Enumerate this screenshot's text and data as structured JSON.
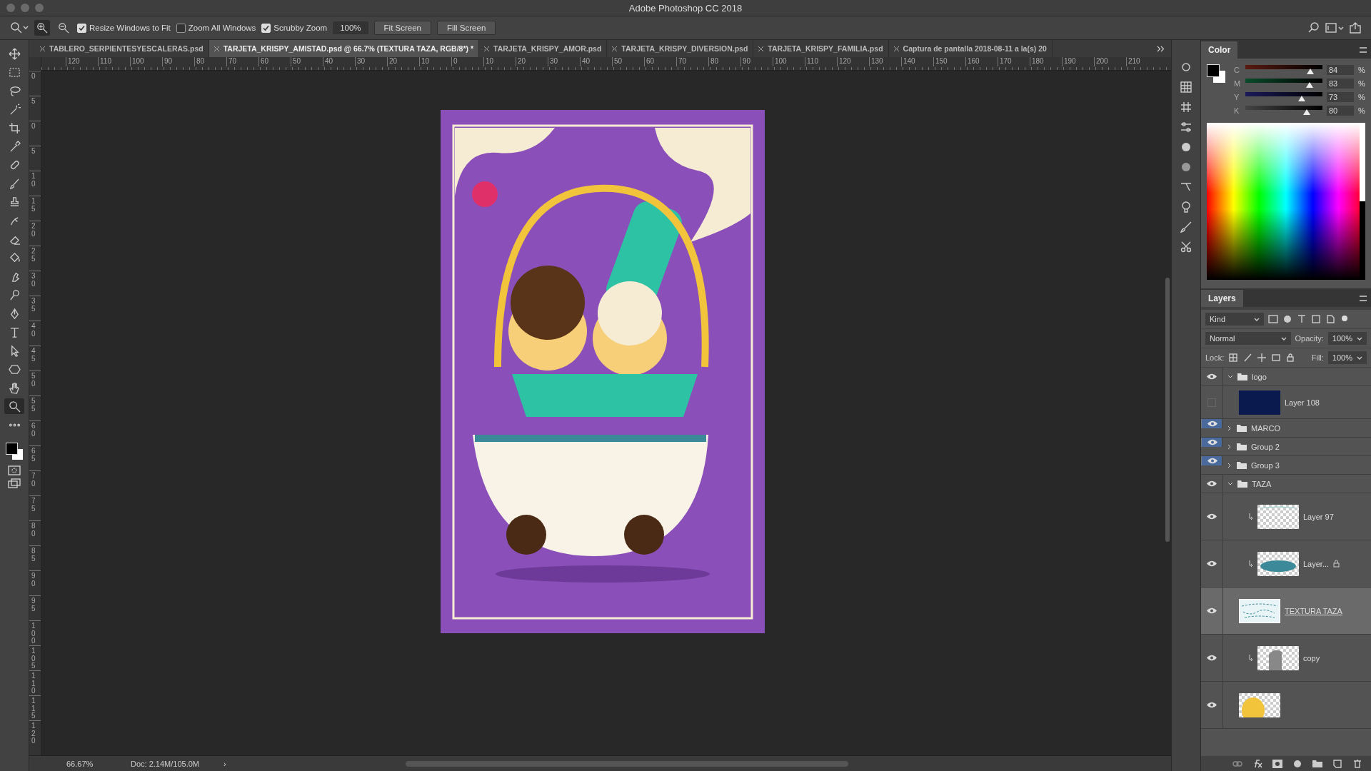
{
  "window": {
    "title": "Adobe Photoshop CC 2018"
  },
  "options_bar": {
    "options": [
      {
        "label": "Resize Windows to Fit",
        "checked": true
      },
      {
        "label": "Zoom All Windows",
        "checked": false
      },
      {
        "label": "Scrubby Zoom",
        "checked": true
      }
    ],
    "zoom_value": "100%",
    "buttons": [
      "Fit Screen",
      "Fill Screen"
    ]
  },
  "tools": [
    {
      "kind": "move",
      "selected": false
    },
    {
      "kind": "marquee",
      "selected": false
    },
    {
      "kind": "lasso",
      "selected": false
    },
    {
      "kind": "wand",
      "selected": false
    },
    {
      "kind": "crop",
      "selected": false
    },
    {
      "kind": "eyedropper",
      "selected": false
    },
    {
      "kind": "healing",
      "selected": false
    },
    {
      "kind": "brush",
      "selected": false
    },
    {
      "kind": "stamp",
      "selected": false
    },
    {
      "kind": "history",
      "selected": false
    },
    {
      "kind": "eraser",
      "selected": false
    },
    {
      "kind": "bucket",
      "selected": false
    },
    {
      "kind": "smudge",
      "selected": false
    },
    {
      "kind": "dodge",
      "selected": false
    },
    {
      "kind": "pen",
      "selected": false
    },
    {
      "kind": "type",
      "selected": false
    },
    {
      "kind": "select",
      "selected": false
    },
    {
      "kind": "shape",
      "selected": false
    },
    {
      "kind": "hand",
      "selected": false
    },
    {
      "kind": "zoom",
      "selected": true
    },
    {
      "kind": "more",
      "selected": false
    }
  ],
  "tabs": [
    {
      "label": "TABLERO_SERPIENTESYESCALERAS.psd",
      "selected": false
    },
    {
      "label": "TARJETA_KRISPY_AMISTAD.psd @ 66.7% (TEXTURA TAZA, RGB/8*) *",
      "selected": true
    },
    {
      "label": "TARJETA_KRISPY_AMOR.psd",
      "selected": false
    },
    {
      "label": "TARJETA_KRISPY_DIVERSION.psd",
      "selected": false
    },
    {
      "label": "TARJETA_KRISPY_FAMILIA.psd",
      "selected": false
    },
    {
      "label": "Captura de pantalla 2018-08-11 a la(s) 20",
      "selected": false
    }
  ],
  "rulers": {
    "horizontal": [
      "120",
      "110",
      "100",
      "90",
      "80",
      "70",
      "60",
      "50",
      "40",
      "30",
      "20",
      "10",
      "0",
      "10",
      "20",
      "30",
      "40",
      "50",
      "60",
      "70",
      "80",
      "90",
      "100",
      "110",
      "120",
      "130",
      "140",
      "150",
      "160",
      "170",
      "180",
      "190",
      "200",
      "210"
    ],
    "vertical": [
      "0",
      "5",
      "0",
      "5",
      "10",
      "15",
      "20",
      "25",
      "30",
      "35",
      "40",
      "45",
      "50",
      "55",
      "60",
      "65",
      "70",
      "75",
      "80",
      "85",
      "90",
      "95",
      "100",
      "105",
      "110",
      "115",
      "120"
    ]
  },
  "color_panel": {
    "title": "Color",
    "channels": [
      {
        "name": "C",
        "value": "84",
        "unit": "%",
        "level": 0.84
      },
      {
        "name": "M",
        "value": "83",
        "unit": "%",
        "level": 0.83
      },
      {
        "name": "Y",
        "value": "73",
        "unit": "%",
        "level": 0.73
      },
      {
        "name": "K",
        "value": "80",
        "unit": "%",
        "level": 0.8
      }
    ]
  },
  "layers_panel": {
    "title": "Layers",
    "filter": "Kind",
    "blend_mode": "Normal",
    "opacity_label": "Opacity:",
    "opacity": "100%",
    "lock_label": "Lock:",
    "fill_label": "Fill:",
    "fill": "100%",
    "layers": [
      {
        "name": "logo",
        "kind": "group",
        "visible": true,
        "eye_highlighted": false,
        "expanded": true,
        "children": [
          {
            "name": "Layer 108",
            "kind": "solid",
            "visible": false,
            "eye_highlighted": false,
            "selected": false,
            "clipped": false,
            "locked": false
          }
        ]
      },
      {
        "name": "MARCO",
        "kind": "group",
        "visible": true,
        "eye_highlighted": true,
        "expanded": false
      },
      {
        "name": "Group 2",
        "kind": "group",
        "visible": true,
        "eye_highlighted": true,
        "expanded": false
      },
      {
        "name": "Group 3",
        "kind": "group",
        "visible": true,
        "eye_highlighted": true,
        "expanded": false
      },
      {
        "name": "TAZA",
        "kind": "group",
        "visible": true,
        "eye_highlighted": false,
        "expanded": true,
        "children": [
          {
            "name": "Layer 97",
            "kind": "transparent",
            "visible": true,
            "eye_highlighted": false,
            "selected": false,
            "clipped": true,
            "locked": false
          },
          {
            "name": "Layer...",
            "kind": "brush",
            "visible": true,
            "eye_highlighted": false,
            "selected": false,
            "clipped": true,
            "locked": true
          },
          {
            "name": "TEXTURA TAZA",
            "kind": "texture",
            "visible": true,
            "eye_highlighted": false,
            "selected": true,
            "clipped": false,
            "locked": false
          },
          {
            "name": "copy",
            "kind": "shape",
            "visible": true,
            "eye_highlighted": false,
            "selected": false,
            "clipped": true,
            "locked": false
          },
          {
            "kind": "yellow",
            "visible": true,
            "eye_highlighted": false,
            "selected": false,
            "clipped": false,
            "locked": false
          }
        ]
      }
    ]
  },
  "status_bar": {
    "zoom": "66.67%",
    "doc": "Doc: 2.14M/105.0M",
    "arrow": "›"
  }
}
